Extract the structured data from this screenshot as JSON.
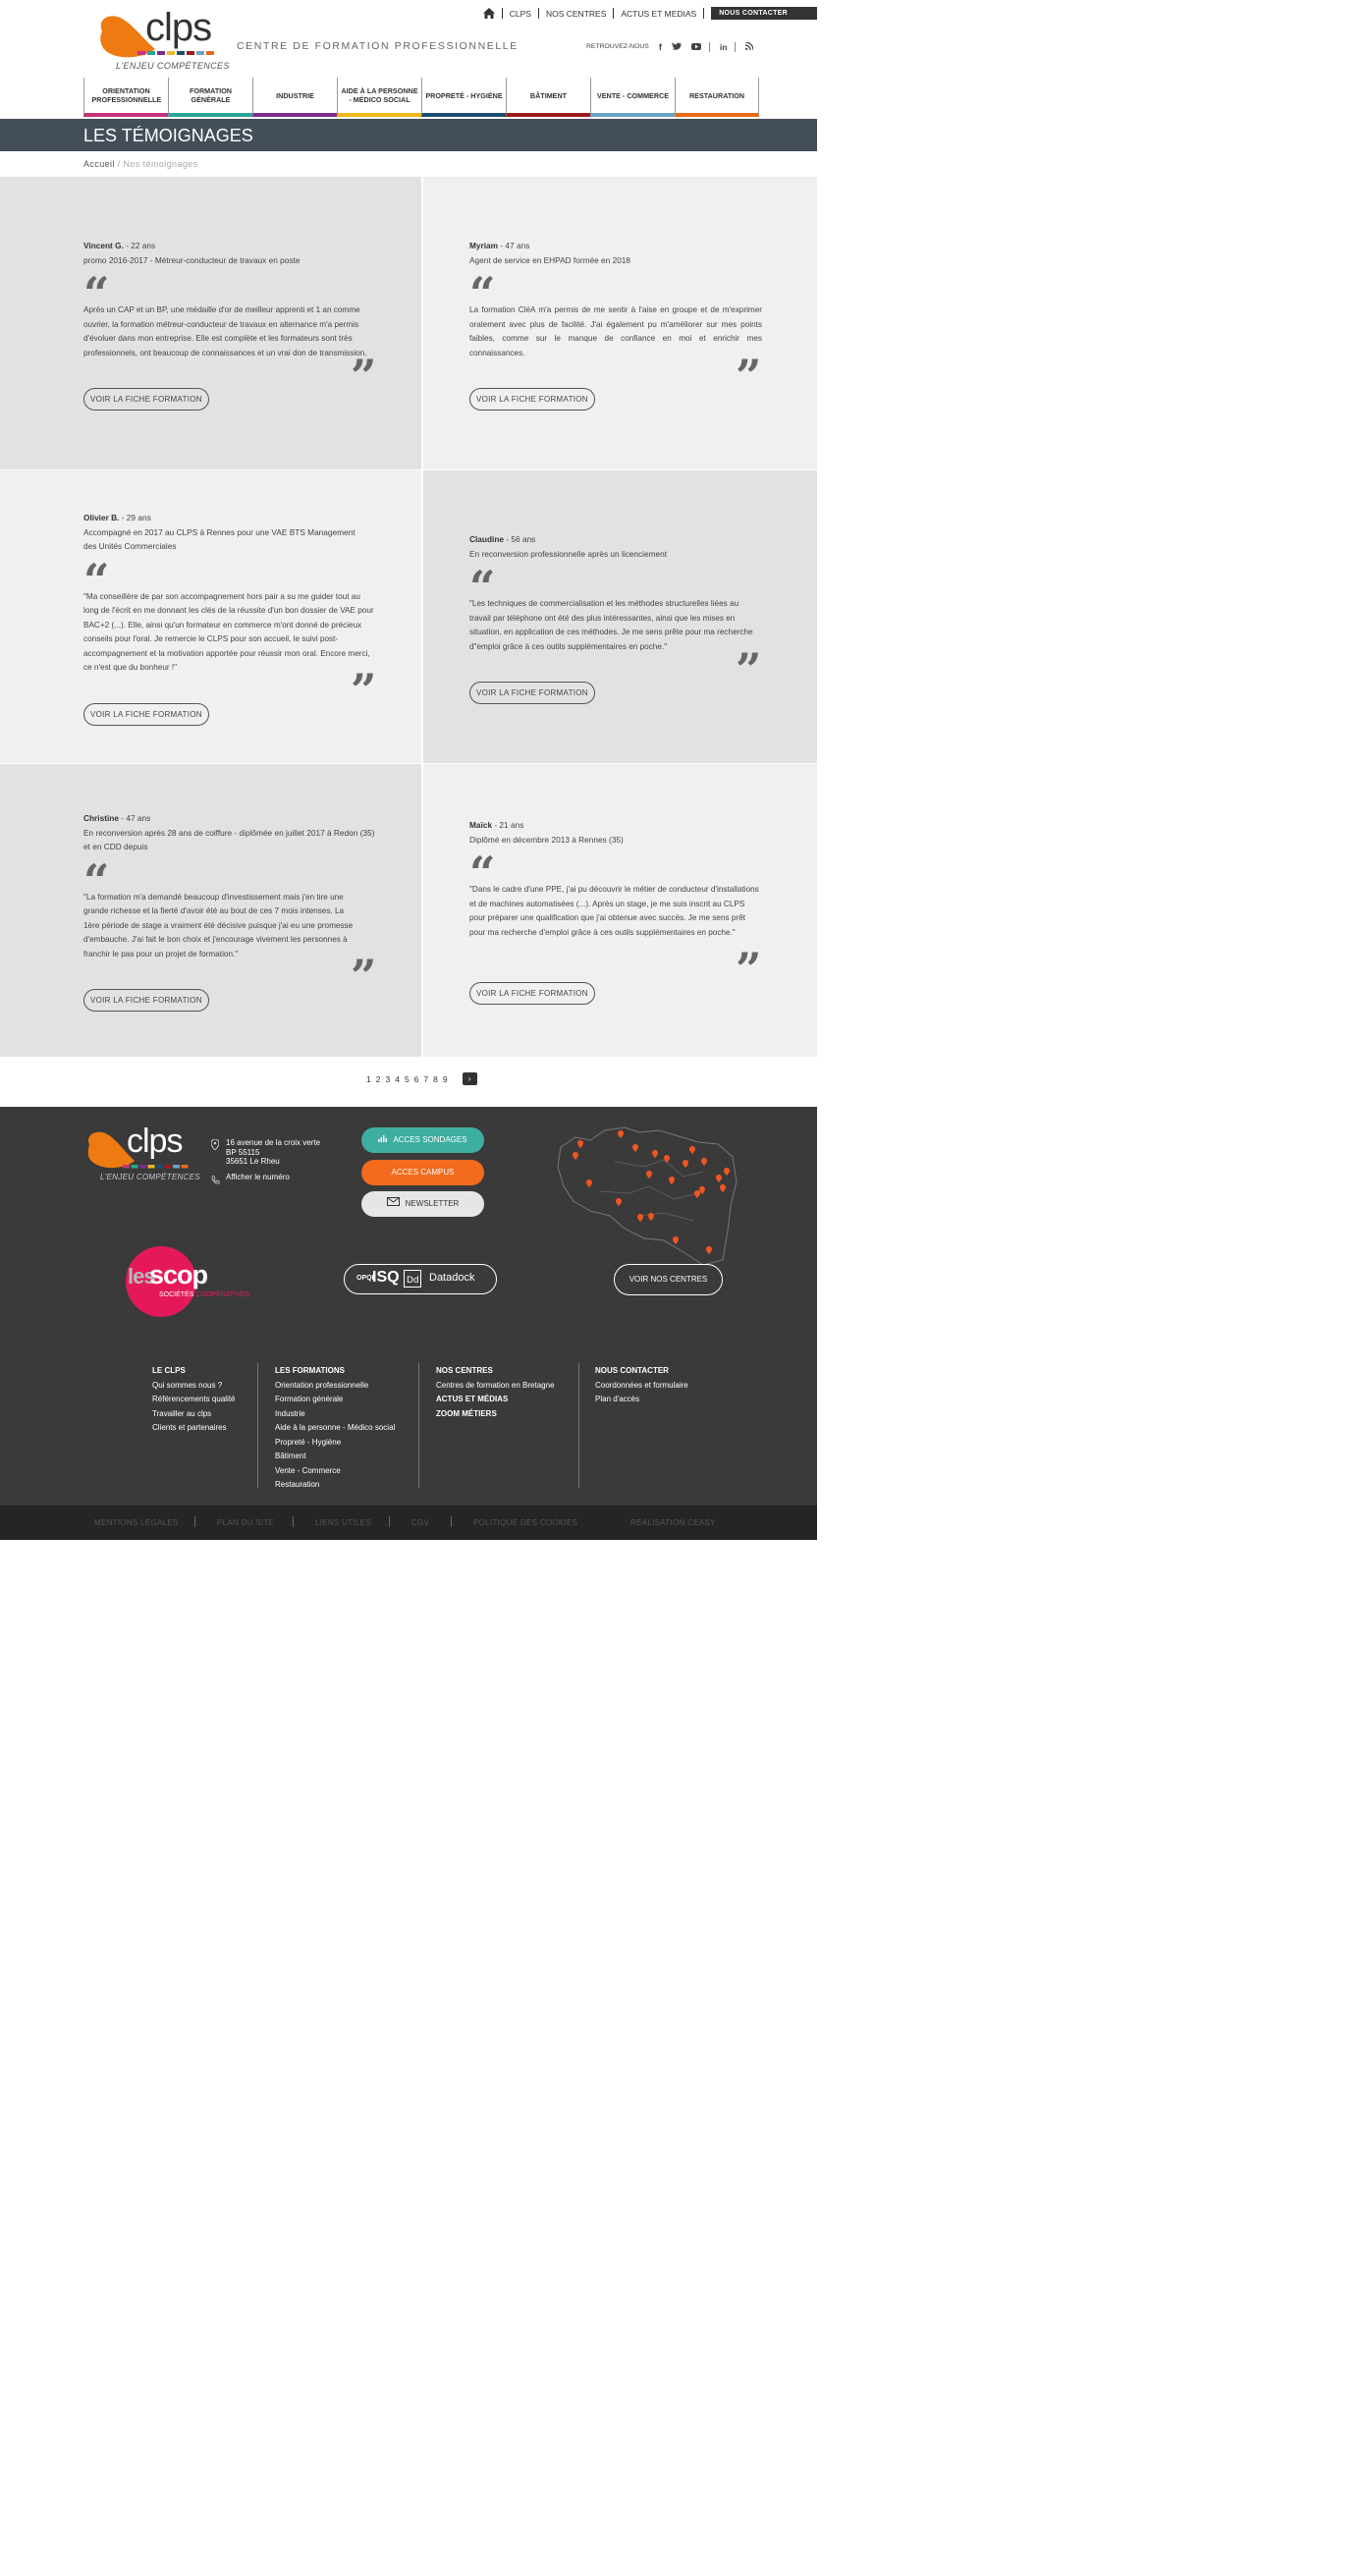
{
  "header": {
    "logo_text": "clps",
    "logo_tagline": "L'ENJEU COMPÉTENCES",
    "tagline": "CENTRE DE FORMATION PROFESSIONNELLE",
    "topnav": [
      "CLPS",
      "NOS CENTRES",
      "ACTUS ET MEDIAS"
    ],
    "contact": "NOUS CONTACTER",
    "social_label": "RETROUVEZ-NOUS",
    "social": [
      "f",
      "🐦",
      "▶",
      "in",
      "rss"
    ],
    "nav": [
      {
        "label": "ORIENTATION PROFESSIONNELLE",
        "color": "#c6327e"
      },
      {
        "label": "FORMATION GÉNÉRALE",
        "color": "#2aa595"
      },
      {
        "label": "INDUSTRIE",
        "color": "#7c2d8c"
      },
      {
        "label": "AIDE À LA PERSONNE - MÉDICO SOCIAL",
        "color": "#f0b71e"
      },
      {
        "label": "PROPRETÉ - HYGIÈNE",
        "color": "#1c4e74"
      },
      {
        "label": "BÂTIMENT",
        "color": "#9d1a1a"
      },
      {
        "label": "VENTE - COMMERCE",
        "color": "#6aa3c8"
      },
      {
        "label": "RESTAURATION",
        "color": "#ea6b16"
      }
    ]
  },
  "page_title": "LES TÉMOIGNAGES",
  "breadcrumb": {
    "home": "Accueil",
    "sep": " / ",
    "current": "Nos témoignages"
  },
  "testimonials": [
    {
      "name": "Vincent G.",
      "age": " - 22 ans",
      "info": "promo 2016-2017 - Métreur-conducteur de travaux en poste",
      "quote": "Après un CAP et un BP, une médaille d'or de meilleur apprenti et 1 an comme ouvrier, la formation métreur-conducteur de travaux en alternance m'a permis d'évoluer dans mon entreprise. Elle est complète et les formateurs sont très professionnels, ont beaucoup de connaissances et un vrai don de transmission.",
      "button": "VOIR LA FICHE FORMATION"
    },
    {
      "name": "Myriam",
      "age": " - 47 ans",
      "info": "Agent de service en EHPAD formée en 2018",
      "quote": "La formation CléA m'a permis de me sentir à l'aise en groupe et de m'exprimer oralement avec plus de facilité. J'ai également pu m'améliorer sur mes points faibles, comme sur le manque de confiance en moi et enrichir mes connaissances.",
      "button": "VOIR LA FICHE FORMATION"
    },
    {
      "name": "Olivier B.",
      "age": " - 29 ans",
      "info": "Accompagné en 2017 au CLPS à Rennes pour une VAE BTS Management des Unités Commerciales",
      "quote": "\"Ma conseillère de par son accompagnement hors pair a su me guider tout au long de l'écrit en me donnant les clés de la réussite d'un bon dossier de VAE pour BAC+2 (...). Elle, ainsi qu'un formateur en commerce m'ont donné de précieux conseils pour l'oral. Je remercie le CLPS pour son accueil, le suivi post-accompagnement et la motivation apportée pour réussir mon oral. Encore merci, ce n'est que du bonheur !\"",
      "button": "VOIR LA FICHE FORMATION"
    },
    {
      "name": "Claudine",
      "age": " - 56 ans",
      "info": "En reconversion professionnelle après un licenciement",
      "quote": "\"Les techniques de commercialisation et les méthodes structurelles liées au travail par téléphone ont été des plus intéressantes, ainsi que les mises en situation, en application de ces méthodes. Je me sens prête pour ma recherche d\"emploi grâce à ces outils supplémentaires en poche.\"",
      "button": "VOIR LA FICHE FORMATION"
    },
    {
      "name": "Christine",
      "age": " - 47 ans",
      "info": "En reconversion après 28 ans de coiffure - diplômée en juillet 2017 à Redon (35) et en CDD depuis",
      "quote": "\"La formation m'a demandé beaucoup d'investissement mais j'en tire une grande richesse et la fierté d'avoir été au bout de ces 7 mois intenses. La 1ère période de stage a vraiment été décisive puisque j'ai eu une promesse d'embauche. J'ai fait le bon choix et j'encourage vivement les personnes à franchir le pas pour un projet de formation.\"",
      "button": "VOIR LA FICHE FORMATION"
    },
    {
      "name": "Maïck",
      "age": " - 21 ans",
      "info": "Diplômé en décembre 2013 à Rennes (35)",
      "quote": "\"Dans le cadre d'une PPE, j'ai pu découvrir le métier de conducteur d'installations et de machines automatisées (...). Après un stage, je me suis inscrit au CLPS pour préparer une qualification que j'ai obtenue avec succès. Je me sens prêt pour ma recherche d'emploi grâce à ces outils supplémentaires en poche.\"",
      "button": "VOIR LA FICHE FORMATION"
    }
  ],
  "pagination": {
    "pages": [
      "1",
      "2",
      "3",
      "4",
      "5",
      "6",
      "7",
      "8",
      "9"
    ],
    "next": "›"
  },
  "footer": {
    "address": [
      "16 avenue de la croix verte",
      "BP 55115",
      "35651 Le Rheu"
    ],
    "phone": "Afficher le numéro",
    "btn_sondages": "ACCES SONDAGES",
    "btn_campus": "ACCES CAMPUS",
    "btn_newsletter": "NEWSLETTER",
    "scop_les": "les",
    "scop_scop": "scop",
    "scop_sub1": "SOCIÉTÉS",
    "scop_sub2": "COOPÉRATIVES",
    "isq": "ISQ",
    "opqf": "OPQF",
    "datadock": "Datadock",
    "btn_centres": "VOIR NOS CENTRES",
    "cols": [
      {
        "title": "LE CLPS",
        "items": [
          "Qui sommes nous ?",
          "Référencements qualité",
          "Travailler au clps",
          "Clients et partenaires"
        ]
      },
      {
        "title": "LES FORMATIONS",
        "items": [
          "Orientation professionnelle",
          "Formation générale",
          "Industrie",
          "Aide à la personne - Médico social",
          "Propreté - Hygiène",
          "Bâtiment",
          "Vente - Commerce",
          "Restauration"
        ]
      },
      {
        "title": "NOS CENTRES",
        "items": [
          "Centres de formation en Bretagne"
        ],
        "extra": [
          "ACTUS ET MÉDIAS",
          "ZOOM MÉTIERS"
        ]
      },
      {
        "title": "NOUS CONTACTER",
        "items": [
          "Coordonnées et formulaire",
          "Plan d'accès"
        ]
      }
    ],
    "bottom_links": [
      "MENTIONS LÉGALES",
      "PLAN DU SITE",
      "LIENS UTILES",
      "CGV",
      "POLITIQUE DES COOKIES"
    ],
    "credit": "RÉALISATION CEASY"
  },
  "colors": {
    "accent_orange": "#f36b1c",
    "teal": "#3daea1",
    "titlebar": "#434e59",
    "footer": "#3a3a3a"
  }
}
